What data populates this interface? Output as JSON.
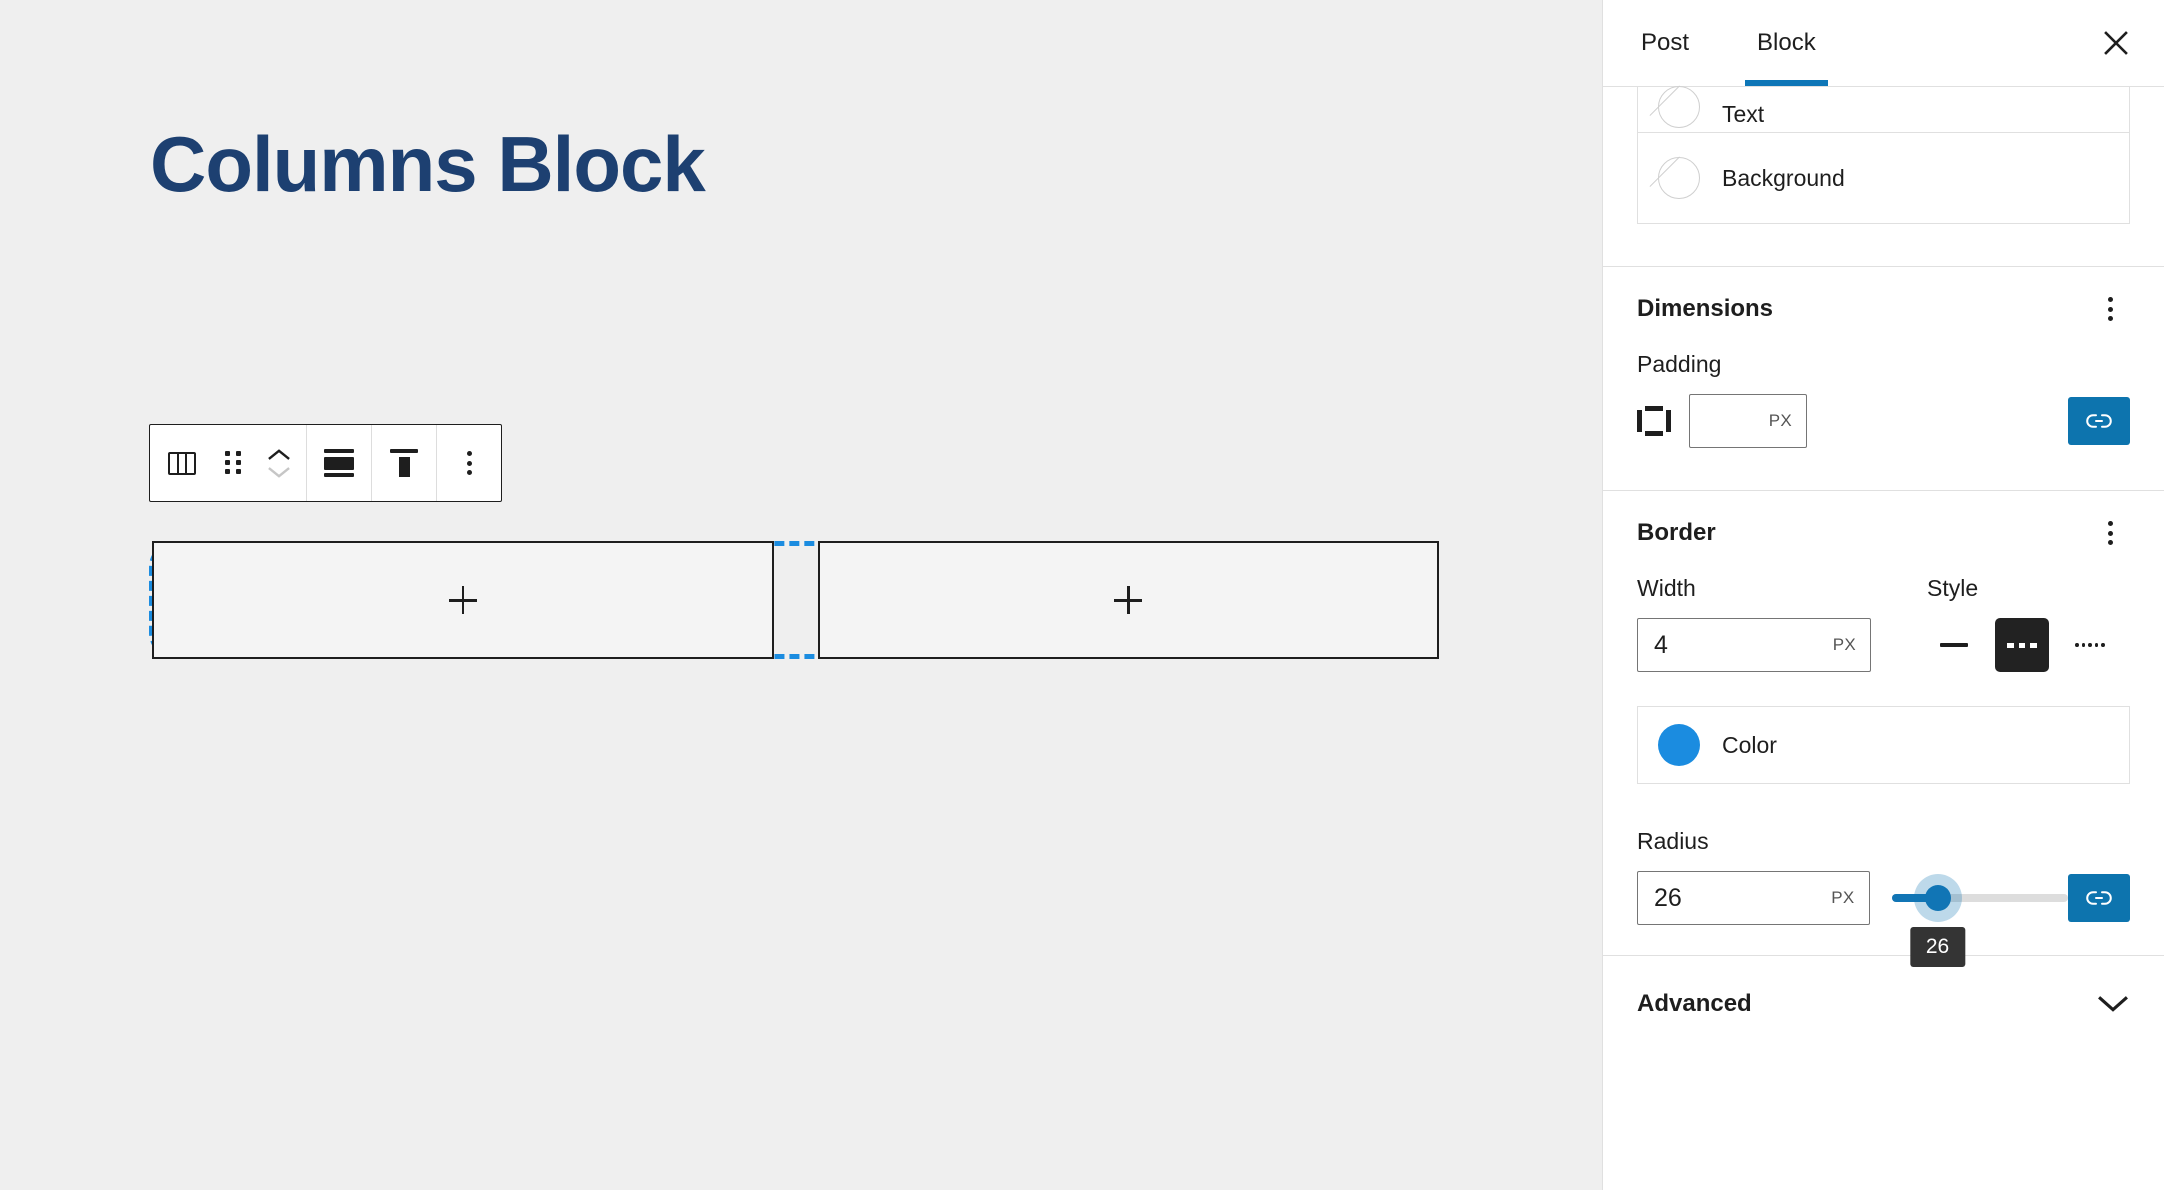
{
  "editor": {
    "post_title": "Columns Block",
    "toolbar": {
      "block_type_icon": "columns-icon",
      "drag_handle_icon": "drag-handle-icon",
      "move_up_icon": "chevron-up-icon",
      "move_down_icon": "chevron-down-icon",
      "align_icon": "change-content-position-icon",
      "vertical_align_icon": "vertical-align-top-icon",
      "options_icon": "more-vertical-icon"
    },
    "columns": [
      {
        "add_label": "+",
        "add_icon": "plus-icon"
      },
      {
        "add_label": "+",
        "add_icon": "plus-icon"
      }
    ],
    "selection_color": "#1b8ce0",
    "selection_radius_px": 26,
    "canvas_bg": "#efefef"
  },
  "sidebar": {
    "tabs": [
      {
        "label": "Post",
        "active": false
      },
      {
        "label": "Block",
        "active": true
      }
    ],
    "close_icon": "close-icon",
    "accent_color": "#0e76b7",
    "colors_panel": {
      "rows": [
        {
          "label": "Text",
          "swatch": "none",
          "icon": "no-color-icon"
        },
        {
          "label": "Background",
          "swatch": "none",
          "icon": "no-color-icon"
        }
      ]
    },
    "dimensions": {
      "title": "Dimensions",
      "more_icon": "more-vertical-icon",
      "padding": {
        "label": "Padding",
        "sides_icon": "box-sides-icon",
        "value": "",
        "placeholder": "",
        "unit": "PX",
        "link_icon": "link-icon",
        "link_active": true
      }
    },
    "border": {
      "title": "Border",
      "more_icon": "more-vertical-icon",
      "width": {
        "label": "Width",
        "value": "4",
        "unit": "PX"
      },
      "style": {
        "label": "Style",
        "options": [
          {
            "name": "solid",
            "icon": "border-solid-icon",
            "active": false
          },
          {
            "name": "dashed",
            "icon": "border-dashed-icon",
            "active": true
          },
          {
            "name": "dotted",
            "icon": "border-dotted-icon",
            "active": false
          }
        ]
      },
      "color": {
        "label": "Color",
        "value": "#1b8ce0"
      },
      "radius": {
        "label": "Radius",
        "value": "26",
        "unit": "PX",
        "slider_value": 26,
        "slider_min": 0,
        "slider_max": 100,
        "tooltip": "26",
        "link_icon": "link-icon",
        "link_active": true
      }
    },
    "advanced": {
      "label": "Advanced",
      "expand_icon": "chevron-down-icon",
      "expanded": false
    }
  }
}
